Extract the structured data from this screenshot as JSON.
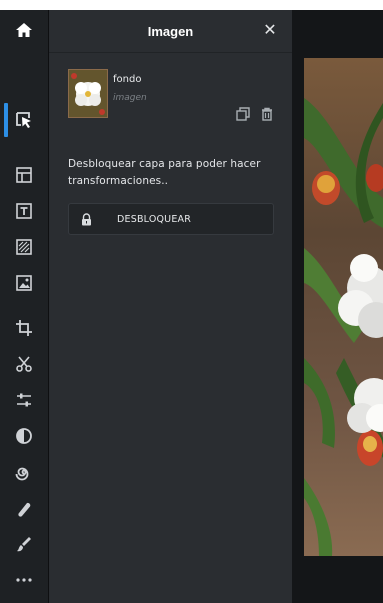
{
  "panel": {
    "title": "Imagen",
    "close_glyph": "✕"
  },
  "layer": {
    "name": "fondo",
    "type": "imagen",
    "duplicate_icon": "duplicate-icon",
    "delete_icon": "trash-icon"
  },
  "lock": {
    "message": "Desbloquear capa para poder hacer transformaciones..",
    "button_label": "DESBLOQUEAR"
  },
  "toolbar": {
    "tools": [
      {
        "name": "home-icon"
      },
      {
        "name": "arrange-select-icon",
        "active": true
      },
      {
        "name": "layout-icon"
      },
      {
        "name": "text-icon"
      },
      {
        "name": "texture-icon"
      },
      {
        "name": "image-icon"
      },
      {
        "name": "crop-icon"
      },
      {
        "name": "cutout-icon"
      },
      {
        "name": "adjust-icon"
      },
      {
        "name": "filter-icon"
      },
      {
        "name": "swirl-icon"
      },
      {
        "name": "retouch-icon"
      },
      {
        "name": "brush-icon"
      },
      {
        "name": "more-icon"
      }
    ],
    "accent_color": "#2d8fe6"
  }
}
